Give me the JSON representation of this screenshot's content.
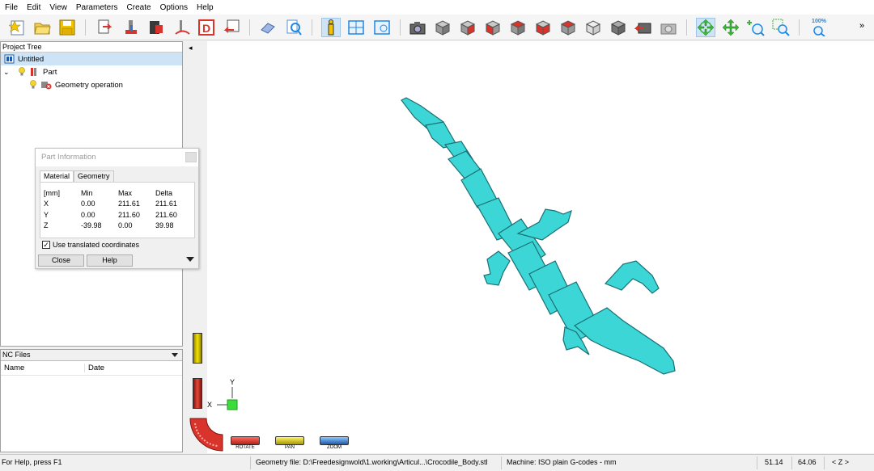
{
  "menu": [
    "File",
    "Edit",
    "View",
    "Parameters",
    "Create",
    "Options",
    "Help"
  ],
  "toolbar": {
    "more": "»",
    "zoom_label": "100%",
    "colors": {
      "accent": "#1e88e5",
      "yellow": "#f2c400",
      "red": "#d9342b",
      "green": "#3db33d",
      "gray": "#8a8a8a"
    }
  },
  "project_tree": {
    "header": "Project Tree",
    "root": "Untitled",
    "part": "Part",
    "operation": "Geometry operation"
  },
  "part_info": {
    "title": "Part Information",
    "tabs": [
      "Material",
      "Geometry"
    ],
    "columns": [
      "[mm]",
      "Min",
      "Max",
      "Delta"
    ],
    "rows": [
      {
        "axis": "X",
        "min": "0.00",
        "max": "211.61",
        "delta": "211.61"
      },
      {
        "axis": "Y",
        "min": "0.00",
        "max": "211.60",
        "delta": "211.60"
      },
      {
        "axis": "Z",
        "min": "-39.98",
        "max": "0.00",
        "delta": "39.98"
      }
    ],
    "checkbox_label": "Use translated coordinates",
    "checked": true,
    "close_label": "Close",
    "help_label": "Help"
  },
  "nc_files": {
    "header": "NC Files",
    "col_name": "Name",
    "col_date": "Date"
  },
  "viewport": {
    "axis_x": "X",
    "axis_y": "Y",
    "model_color": "#3dd6d6",
    "model_edge": "#1a6f73",
    "rotate_label": "ROTATE",
    "pan_label": "PAN",
    "zoom_label": "ZOOM",
    "collapse_glyph": "◂"
  },
  "status": {
    "help": "For Help, press F1",
    "geometry_file": "Geometry file: D:\\Freedesignwold\\1.working\\Articul...\\Crocodile_Body.stl",
    "machine": "Machine: ISO plain G-codes - mm",
    "x": "51.14",
    "y": "64.06",
    "z": "< Z >"
  }
}
